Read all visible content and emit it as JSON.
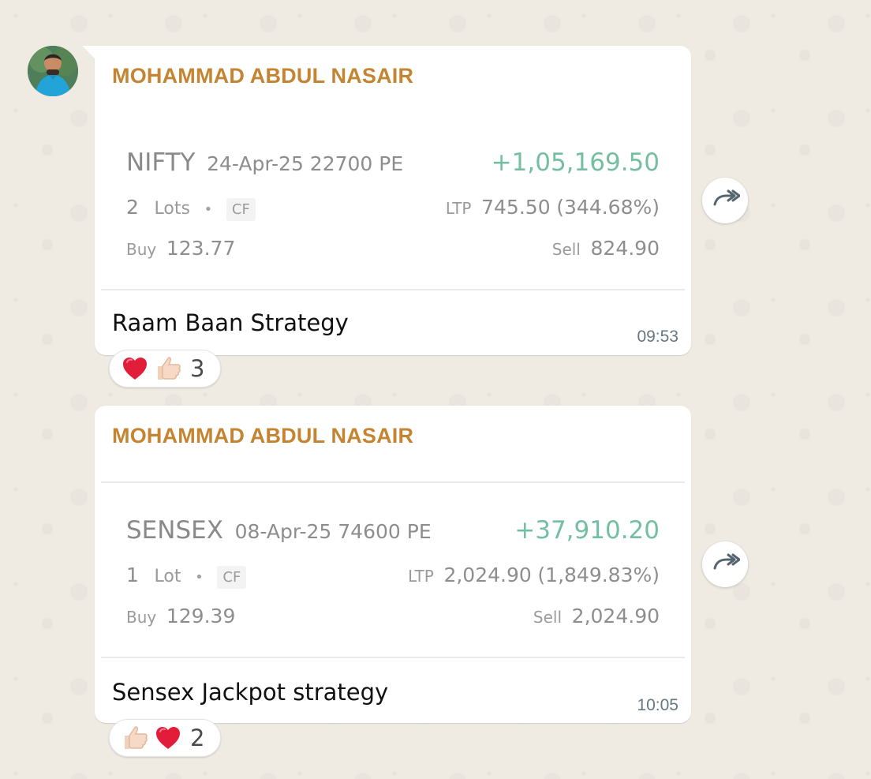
{
  "messages": [
    {
      "sender": "MOHAMMAD ABDUL NASAIR",
      "trade": {
        "symbol": "NIFTY",
        "contract": "24-Apr-25 22700 PE",
        "pnl": "+1,05,169.50",
        "lots_count": "2",
        "lots_label": "Lots",
        "flag": "CF",
        "ltp_label": "LTP",
        "ltp_value": "745.50",
        "ltp_change": "(344.68%)",
        "buy_label": "Buy",
        "buy_value": "123.77",
        "sell_label": "Sell",
        "sell_value": "824.90"
      },
      "caption": "Raam Baan Strategy",
      "time": "09:53",
      "reactions": {
        "icons": [
          "heart-icon",
          "thumbs-up-icon"
        ],
        "count": "3"
      }
    },
    {
      "sender": "MOHAMMAD ABDUL NASAIR",
      "trade": {
        "symbol": "SENSEX",
        "contract": "08-Apr-25 74600 PE",
        "pnl": "+37,910.20",
        "lots_count": "1",
        "lots_label": "Lot",
        "flag": "CF",
        "ltp_label": "LTP",
        "ltp_value": "2,024.90",
        "ltp_change": "(1,849.83%)",
        "buy_label": "Buy",
        "buy_value": "129.39",
        "sell_label": "Sell",
        "sell_value": "2,024.90"
      },
      "caption": "Sensex Jackpot strategy",
      "time": "10:05",
      "reactions": {
        "icons": [
          "thumbs-up-icon",
          "heart-icon"
        ],
        "count": "2"
      }
    }
  ],
  "colors": {
    "chat_background": "#efeae2",
    "sender_name": "#c48431",
    "profit_green": "#74bfa2",
    "bubble": "#ffffff"
  }
}
